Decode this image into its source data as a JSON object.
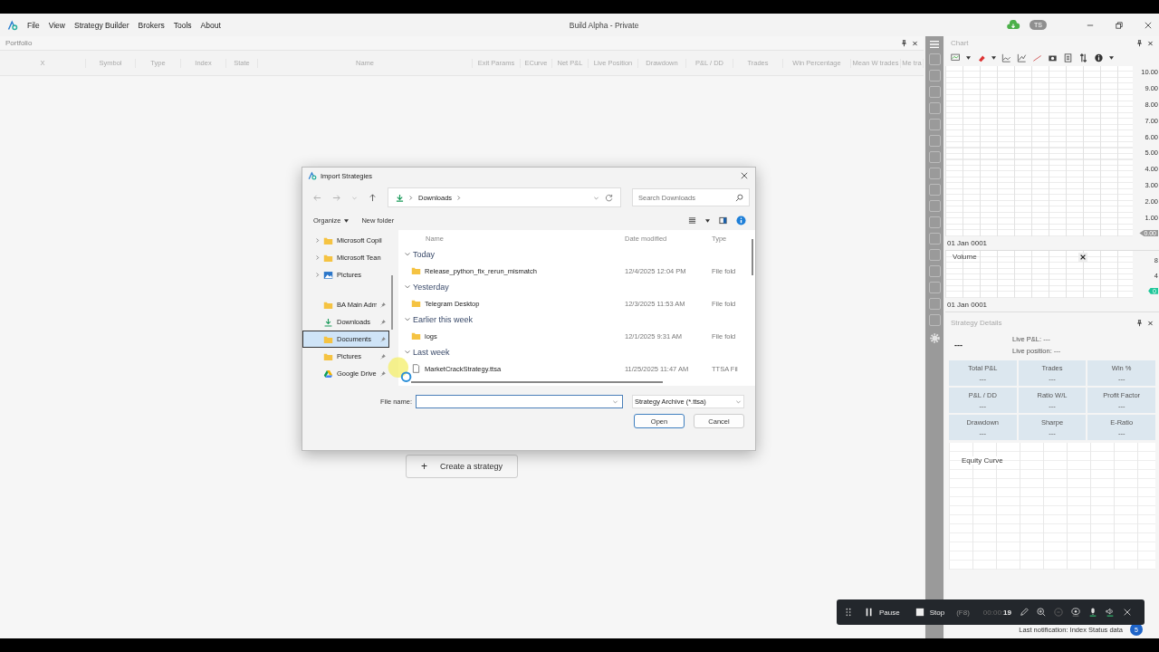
{
  "window": {
    "title": "Build Alpha - Private",
    "menu": [
      "File",
      "View",
      "Strategy Builder",
      "Brokers",
      "Tools",
      "About"
    ],
    "avatar": "TS"
  },
  "portfolio": {
    "title": "Portfolio",
    "columns": [
      "X",
      "Symbol",
      "Type",
      "Index",
      "State",
      "Name",
      "Exit Params",
      "ECurve",
      "Net P&L",
      "Live Position",
      "Drawdown",
      "P&L / DD",
      "Trades",
      "Win Percentage",
      "Mean W trades",
      "Me tra"
    ],
    "create_button": "Create a strategy",
    "create_icon": "+"
  },
  "chart": {
    "title": "Chart",
    "price_labels": [
      "10.00",
      "9.00",
      "8.00",
      "7.00",
      "6.00",
      "5.00",
      "4.00",
      "3.00",
      "2.00",
      "1.00"
    ],
    "price_marker": "0.00",
    "date": "01 Jan 0001",
    "volume": {
      "title": "Volume",
      "labels": [
        "8",
        "4"
      ],
      "marker": "0",
      "date": "01 Jan 0001"
    }
  },
  "strategy_details": {
    "title": "Strategy Details",
    "headline": "---",
    "live_pnl": "Live P&L: ---",
    "live_position": "Live position: ---",
    "tiles": [
      {
        "label": "Total P&L",
        "value": "---"
      },
      {
        "label": "Trades",
        "value": "---"
      },
      {
        "label": "Win %",
        "value": "---"
      },
      {
        "label": "P&L / DD",
        "value": "---"
      },
      {
        "label": "Ratio W/L",
        "value": "---"
      },
      {
        "label": "Profit Factor",
        "value": "---"
      },
      {
        "label": "Drawdown",
        "value": "---"
      },
      {
        "label": "Sharpe",
        "value": "---"
      },
      {
        "label": "E-Ratio",
        "value": "---"
      }
    ],
    "equity_title": "Equity Curve"
  },
  "dialog": {
    "title": "Import Strategies",
    "path": "Downloads",
    "search_placeholder": "Search Downloads",
    "organize": "Organize",
    "new_folder": "New folder",
    "nav": [
      {
        "label": "Microsoft Copil",
        "kind": "expandable",
        "selected": false
      },
      {
        "label": "Microsoft Tean",
        "kind": "expandable",
        "selected": false
      },
      {
        "label": "Pictures",
        "kind": "expandable",
        "selected": false
      },
      {
        "label": "BA Main Adm",
        "kind": "pinned",
        "selected": false
      },
      {
        "label": "Downloads",
        "kind": "pinned",
        "selected": false
      },
      {
        "label": "Documents",
        "kind": "pinned",
        "selected": true
      },
      {
        "label": "Pictures",
        "kind": "pinned",
        "selected": false
      },
      {
        "label": "Google Drive",
        "kind": "pinned",
        "selected": false
      }
    ],
    "columns": [
      "Name",
      "Date modified",
      "Type"
    ],
    "groups": [
      {
        "title": "Today",
        "expanded": true,
        "files": [
          {
            "name": "Release_python_fix_rerun_mismatch",
            "kind": "folder",
            "date": "12/4/2025 12:04 PM",
            "type": "File fold"
          }
        ]
      },
      {
        "title": "Yesterday",
        "expanded": true,
        "files": [
          {
            "name": "Telegram Desktop",
            "kind": "folder",
            "date": "12/3/2025 11:53 AM",
            "type": "File fold"
          }
        ]
      },
      {
        "title": "Earlier this week",
        "expanded": true,
        "files": [
          {
            "name": "logs",
            "kind": "folder",
            "date": "12/1/2025 9:31 AM",
            "type": "File fold"
          }
        ]
      },
      {
        "title": "Last week",
        "expanded": true,
        "files": [
          {
            "name": "MarketCrackStrategy.ttsa",
            "kind": "file",
            "date": "11/25/2025 11:47 AM",
            "type": "TTSA Fil"
          }
        ]
      }
    ],
    "file_name_label": "File name:",
    "file_type": "Strategy Archive (*.ttsa)",
    "open": "Open",
    "cancel": "Cancel"
  },
  "recorder": {
    "pause": "Pause",
    "stop": "Stop",
    "shortcut": "(F8)",
    "time": "00:00:**19**"
  },
  "status": {
    "notification": "Last notification: Index Status data",
    "badge": "5"
  }
}
